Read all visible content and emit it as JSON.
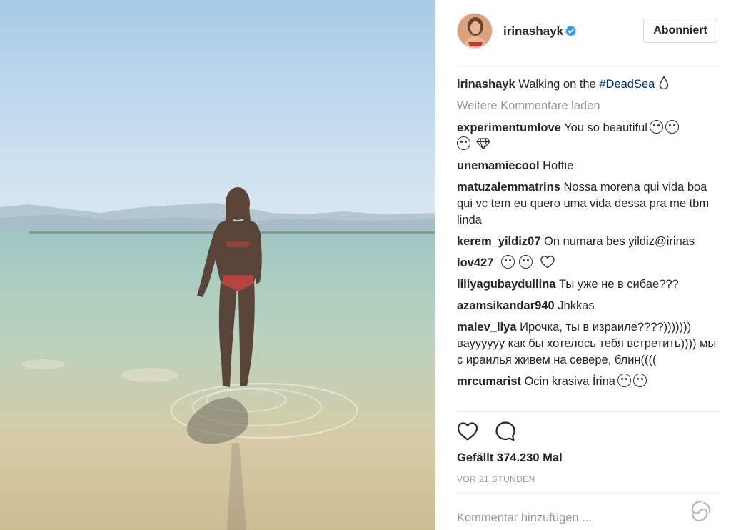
{
  "header": {
    "username": "irinashayk",
    "follow_label": "Abonniert"
  },
  "caption": {
    "user": "irinashayk",
    "text": "Walking on the ",
    "hashtag": "#DeadSea"
  },
  "load_more": "Weitere Kommentare laden",
  "comments": [
    {
      "user": "experimentumlove",
      "text": "You so beautiful"
    },
    {
      "user": "unemamiecool",
      "text": "Hottie"
    },
    {
      "user": "matuzalemmatrins",
      "text": "Nossa morena qui vida boa qui vc tem eu quero uma vida dessa pra me tbm linda"
    },
    {
      "user": "kerem_yildiz07",
      "text": "On numara bes yildiz@irinas"
    },
    {
      "user": "lov427",
      "text": ""
    },
    {
      "user": "liliyagubaydullina",
      "text": "Ты уже не в сибае???"
    },
    {
      "user": "azamsikandar940",
      "text": "Jhkkas"
    },
    {
      "user": "malev_liya",
      "text": "Ирочка, ты в израиле????))))))) вауууууу как бы хотелось тебя встретить)))) мы с ираилья живем на севере, блин(((("
    },
    {
      "user": "mrcumarist",
      "text": "Ocin krasiva İrina"
    }
  ],
  "likes_text": "Gefällt 374.230 Mal",
  "timestamp": "VOR 21 STUNDEN",
  "comment_input": {
    "placeholder": "Kommentar hinzufügen ..."
  },
  "icons": {
    "like": "heart-outline-icon",
    "comment": "speech-bubble-icon",
    "verified": "verified-badge-icon"
  },
  "colors": {
    "verified_blue": "#3897f0",
    "hashtag_blue": "#003569",
    "muted_gray": "#999999",
    "text_dark": "#262626"
  }
}
